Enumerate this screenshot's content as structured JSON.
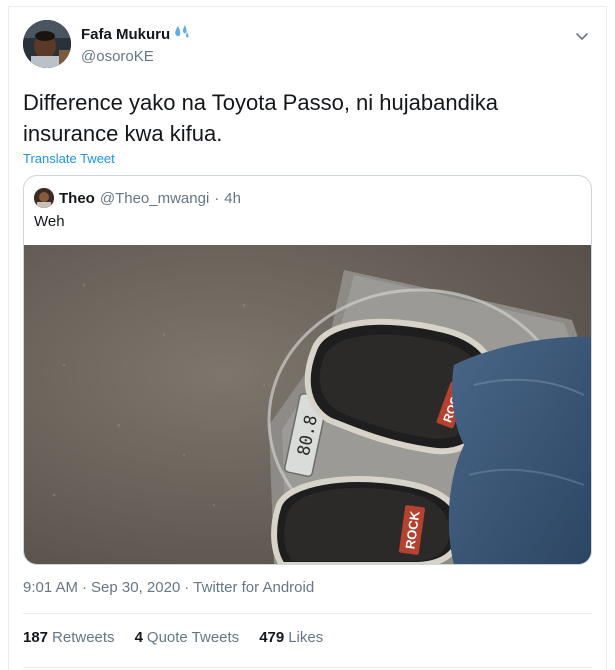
{
  "author": {
    "name": "Fafa Mukuru",
    "handle": "@osoroKE"
  },
  "tweet": {
    "text": "Difference yako na Toyota Passo, ni hujabandika insurance kwa kifua.",
    "translate_label": "Translate Tweet"
  },
  "quoted": {
    "name": "Theo",
    "handle": "@Theo_mwangi",
    "separator": "·",
    "time": "4h",
    "text": "Weh",
    "image_text": {
      "scale_display": "80.8",
      "shoe_brand_1": "ROCK",
      "shoe_brand_2": "ROCK"
    }
  },
  "meta": {
    "time": "9:01 AM",
    "sep1": "·",
    "date": "Sep 30, 2020",
    "sep2": "·",
    "source": "Twitter for Android"
  },
  "stats": {
    "retweets_count": "187",
    "retweets_label": "Retweets",
    "quotes_count": "4",
    "quotes_label": "Quote Tweets",
    "likes_count": "479",
    "likes_label": "Likes"
  },
  "colors": {
    "link": "#1b95e0",
    "secondary_text": "#657786",
    "border": "#e6ecf0"
  },
  "icons": {
    "emoji": "sweat-droplets-icon",
    "menu": "chevron-down-icon"
  }
}
